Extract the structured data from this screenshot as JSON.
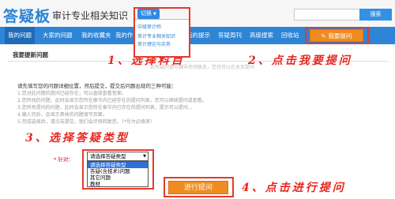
{
  "header": {
    "logo": "答疑板",
    "subject": "审计专业相关知识",
    "switch_label": "切换",
    "search_placeholder": "",
    "search_button": "搜索"
  },
  "dropdown": {
    "items": [
      "中级审计师",
      "审计专业相关知识",
      "审计理论与实务"
    ]
  },
  "nav": {
    "items": [
      "我的问题",
      "大家的问题",
      "我的收藏夹",
      "我的作业",
      "我的提示",
      "答疑周刊",
      "高级搜索",
      "回收站"
    ],
    "ask_label": "我要提问"
  },
  "main": {
    "page_title": "我要提新问题",
    "background_note": "若有疑问请与辅导老师联系，您也可以在本页提问",
    "notice": "请先填写您的问题详细位置，然后提交，提交后问题出现的三种可能：",
    "tips": [
      "1.您对此问题的提问已经存在，可以直接查看答案。",
      "2.您所找的问题，此时会显示您所在章节内已经存在的提问列表，您可以继续提问或查看。",
      "3.您所有提问的问题，此时会显示您所在章节内已存在的提问列表，提示可以提问...",
      "4.输入完后，会显示具体的问题填写页面。",
      "5.完成选择后，请点击提交，我们会尽快回复您。（*号为必填项）"
    ],
    "type_label": "* 针对",
    "type_label_suffix": "：",
    "type_select_value": "请选择答疑类型",
    "type_options": [
      "请选择答疑类型",
      "答疑(含技术)问题",
      "其它问题",
      "教材"
    ],
    "submit_label": "进行提问"
  },
  "annotations": {
    "step1": "1、选择科目",
    "step2": "2、点击我要提问",
    "step3": "3、选择答疑类型",
    "step4": "4、点击进行提问"
  },
  "colors": {
    "brand_blue": "#2e84d5",
    "accent_orange": "#f08c1e",
    "annotation_red": "#e8261f"
  }
}
